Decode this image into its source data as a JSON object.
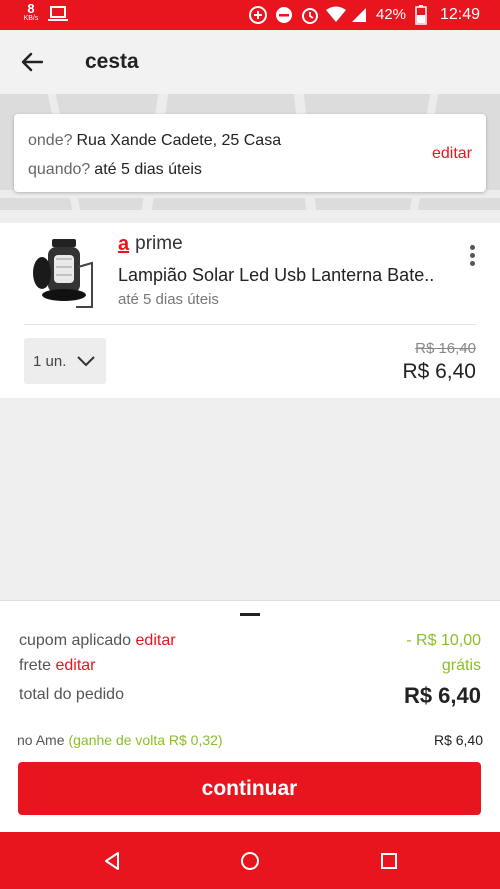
{
  "status_bar": {
    "net_speed_value": "8",
    "net_speed_unit": "KB/s",
    "battery_percent": "42%",
    "time": "12:49"
  },
  "toolbar": {
    "title": "cesta",
    "back_icon": "arrow-left-icon"
  },
  "delivery": {
    "where_label": "onde?",
    "where_value": "Rua Xande Cadete, 25 Casa",
    "when_label": "quando?",
    "when_value": "até 5 dias úteis",
    "edit_label": "editar"
  },
  "product": {
    "badge_logo": "a",
    "badge_text": "prime",
    "name": "Lampião Solar Led Usb Lanterna Bate..",
    "delivery_time": "até 5 dias úteis",
    "quantity": "1 un.",
    "old_price": "R$ 16,40",
    "price": "R$ 6,40"
  },
  "summary": {
    "coupon_label": "cupom aplicado",
    "coupon_edit": "editar",
    "coupon_value": "- R$ 10,00",
    "shipping_label": "frete",
    "shipping_edit": "editar",
    "shipping_value": "grátis",
    "total_label": "total do pedido",
    "total_value": "R$ 6,40",
    "ame_label": "no Ame",
    "ame_cashback": "(ganhe de volta R$ 0,32)",
    "ame_value": "R$ 6,40",
    "continue_label": "continuar"
  },
  "colors": {
    "brand_red": "#e8141e",
    "accent_green": "#8cbd2a"
  }
}
